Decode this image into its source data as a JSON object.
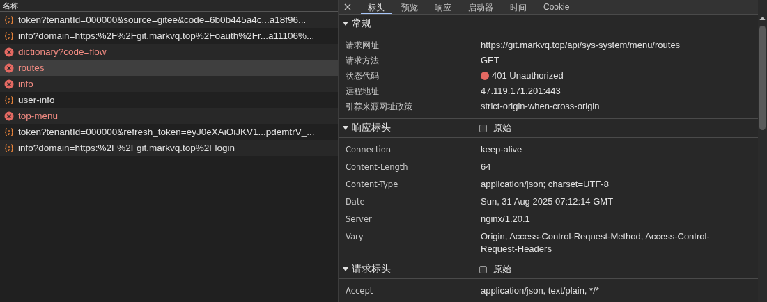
{
  "request_list": {
    "column_header": "名称",
    "rows": [
      {
        "name": "token?tenantId=000000&source=gitee&code=6b0b445a4c...a18f96...",
        "kind": "fetch",
        "selected": false
      },
      {
        "name": "info?domain=https:%2F%2Fgit.markvq.top%2Foauth%2Fr...a11106%...",
        "kind": "fetch",
        "selected": false
      },
      {
        "name": "dictionary?code=flow",
        "kind": "error",
        "selected": false
      },
      {
        "name": "routes",
        "kind": "error",
        "selected": true
      },
      {
        "name": "info",
        "kind": "error",
        "selected": false
      },
      {
        "name": "user-info",
        "kind": "fetch",
        "selected": false
      },
      {
        "name": "top-menu",
        "kind": "error",
        "selected": false
      },
      {
        "name": "token?tenantId=000000&refresh_token=eyJ0eXAiOiJKV1...pdemtrV_...",
        "kind": "fetch",
        "selected": false
      },
      {
        "name": "info?domain=https:%2F%2Fgit.markvq.top%2Flogin",
        "kind": "fetch",
        "selected": false
      }
    ]
  },
  "detail_tabs": [
    {
      "label": "标头",
      "selected": true
    },
    {
      "label": "预览",
      "selected": false
    },
    {
      "label": "响应",
      "selected": false
    },
    {
      "label": "启动器",
      "selected": false
    },
    {
      "label": "时间",
      "selected": false
    },
    {
      "label": "Cookie",
      "selected": false
    }
  ],
  "sections": [
    {
      "title": "常规",
      "expanded": true,
      "rows": [
        {
          "key": "请求网址",
          "value": "https://git.markvq.top/api/sys-system/menu/routes",
          "kind": "text"
        },
        {
          "key": "请求方法",
          "value": "GET",
          "kind": "text"
        },
        {
          "key": "状态代码",
          "value": "401 Unauthorized",
          "kind": "status"
        },
        {
          "key": "远程地址",
          "value": "47.119.171.201:443",
          "kind": "text"
        },
        {
          "key": "引荐来源网址政策",
          "value": "strict-origin-when-cross-origin",
          "kind": "text"
        }
      ]
    },
    {
      "title": "响应标头",
      "expanded": true,
      "raw_label": "原始",
      "raw_checked": false,
      "rows": [
        {
          "key": "Connection",
          "value": "keep-alive",
          "kind": "header"
        },
        {
          "key": "Content-Length",
          "value": "64",
          "kind": "header"
        },
        {
          "key": "Content-Type",
          "value": "application/json; charset=UTF-8",
          "kind": "header"
        },
        {
          "key": "Date",
          "value": "Sun, 31 Aug 2025 07:12:14 GMT",
          "kind": "header"
        },
        {
          "key": "Server",
          "value": "nginx/1.20.1",
          "kind": "header"
        },
        {
          "key": "Vary",
          "value": "Origin, Access-Control-Request-Method, Access-Control-Request-Headers",
          "kind": "header"
        }
      ]
    },
    {
      "title": "请求标头",
      "expanded": true,
      "raw_label": "原始",
      "raw_checked": false,
      "rows": [
        {
          "key": "Accept",
          "value": "application/json, text/plain, */*",
          "kind": "header"
        }
      ]
    }
  ]
}
